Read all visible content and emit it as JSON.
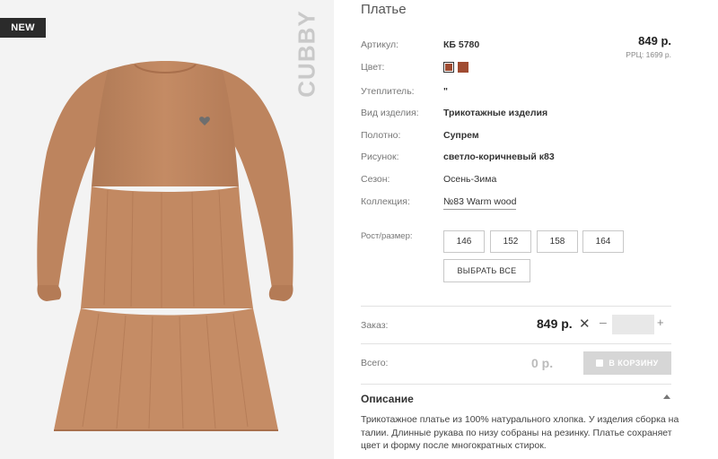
{
  "badge": "NEW",
  "brand": "CUBBY",
  "product": {
    "title": "Платье",
    "price": "849 р.",
    "rrp": "РРЦ: 1699 р."
  },
  "specs": {
    "article_label": "Артикул:",
    "article_value": "КБ 5780",
    "color_label": "Цвет:",
    "insulation_label": "Утеплитель:",
    "insulation_value": "\"",
    "type_label": "Вид изделия:",
    "type_value": "Трикотажные изделия",
    "fabric_label": "Полотно:",
    "fabric_value": "Супрем",
    "pattern_label": "Рисунок:",
    "pattern_value": "светло-коричневый к83",
    "season_label": "Сезон:",
    "season_value": "Осень-Зима",
    "collection_label": "Коллекция:",
    "collection_value": "№83 Warm wood"
  },
  "colors": {
    "swatch": "#a04c32"
  },
  "sizes": {
    "label": "Рост/размер:",
    "options": [
      "146",
      "152",
      "158",
      "164"
    ],
    "select_all": "ВЫБРАТЬ ВСЕ"
  },
  "order": {
    "label": "Заказ:",
    "price": "849 р.",
    "times": "✕",
    "minus": "–",
    "plus": "+",
    "quantity": ""
  },
  "total": {
    "label": "Всего:",
    "value": "0 р.",
    "cart_button": "В КОРЗИНУ"
  },
  "description": {
    "title": "Описание",
    "text": "Трикотажное платье из 100% натурального хлопка. У изделия сборка на талии. Длинные рукава по низу собраны на резинку. Платье сохраняет цвет и форму после многократных стирок."
  }
}
